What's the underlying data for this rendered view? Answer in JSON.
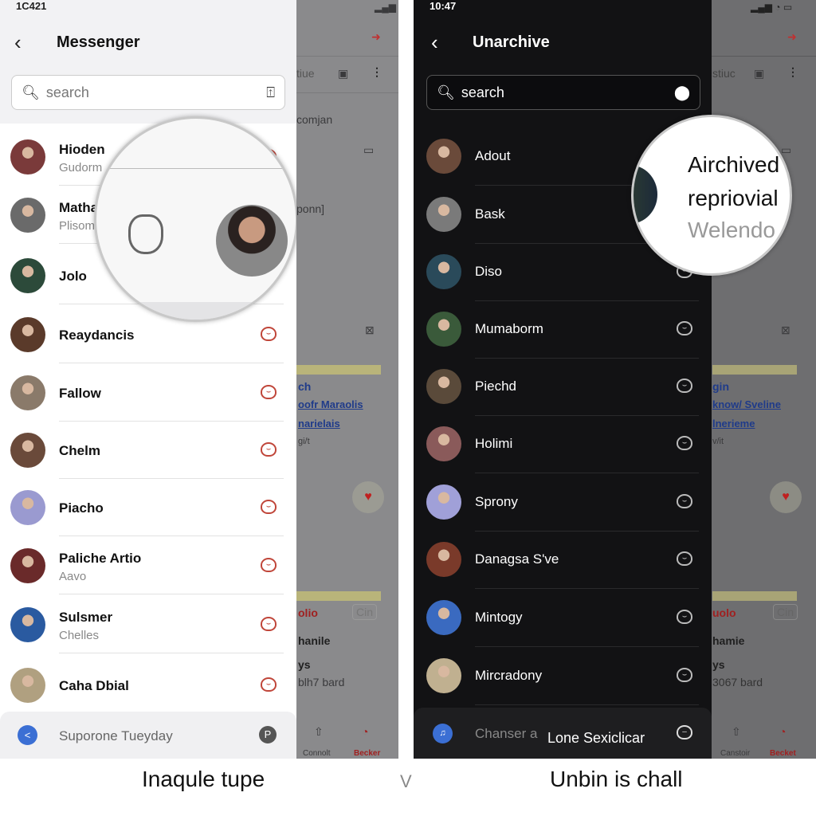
{
  "left_screen": {
    "status_time": "1C421",
    "title": "Messenger",
    "search_placeholder": "search",
    "contacts": [
      {
        "name": "Hioden",
        "subtitle": "Gudorm"
      },
      {
        "name": "Matha",
        "subtitle": "Plisom"
      },
      {
        "name": "Jolo",
        "subtitle": ""
      },
      {
        "name": "Reaydancis",
        "subtitle": ""
      },
      {
        "name": "Fallow",
        "subtitle": ""
      },
      {
        "name": "Chelm",
        "subtitle": ""
      },
      {
        "name": "Piacho",
        "subtitle": ""
      },
      {
        "name": "Paliche Artio",
        "subtitle": "Aavo"
      },
      {
        "name": "Sulsmer",
        "subtitle": "Chelles"
      },
      {
        "name": "Caha Dbial",
        "subtitle": ""
      }
    ],
    "bottom_bar_label": "Suporone Tueyday",
    "bottom_bar_badge": "P",
    "caption": "Inaqule tupe",
    "background": {
      "t1": "tiue",
      "t2": "comjan",
      "t3": "ponn]",
      "l1": "ch",
      "l2": "oofr Maraolis",
      "l3": "narielais",
      "l4": "gi/t",
      "r1": "olio",
      "btn": "Cin",
      "b1": "hanile",
      "b2": "ys",
      "b3": "blh7 bard",
      "tab1": "Connolt",
      "tab2": "Becker"
    }
  },
  "separator": "V",
  "right_screen": {
    "status_time": "10:47",
    "title": "Unarchive",
    "search_placeholder": "search",
    "contacts": [
      {
        "name": "Adout"
      },
      {
        "name": "Bask"
      },
      {
        "name": "Diso"
      },
      {
        "name": "Mumaborm"
      },
      {
        "name": "Piechd"
      },
      {
        "name": "Holimi"
      },
      {
        "name": "Sprony"
      },
      {
        "name": "Danagsa S've"
      },
      {
        "name": "Mintogy"
      },
      {
        "name": "Mircradony"
      }
    ],
    "magnifier": {
      "line1": "Airchived",
      "line2": "repriovial",
      "line3": "Welendo"
    },
    "bottom_bar_label": "Chanser a",
    "bottom_bar_overlay": "Lone Sexiclicar",
    "caption": "Unbin is chall",
    "background": {
      "t1": "stiuc",
      "l1": "gin",
      "l2": "know/ Sveline",
      "l3": "lneriemе",
      "l4": "v/it",
      "r1": "uolo",
      "btn": "Cin",
      "b1": "hamie",
      "b2": "ys",
      "b3": "3067 bard",
      "tab1": "Canstoir",
      "tab2": "Becket"
    }
  },
  "colors": {
    "accent_red": "#c0463a",
    "blue": "#3b6fd4",
    "dark_bg": "#121214"
  }
}
